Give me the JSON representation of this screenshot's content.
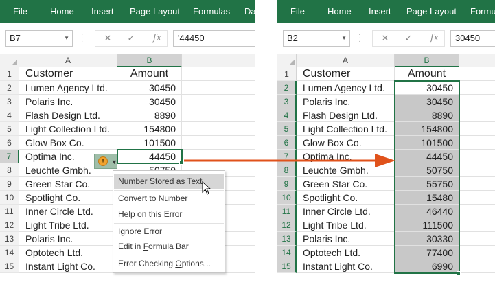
{
  "ribbon": {
    "left_tabs": [
      "File",
      "Home",
      "Insert",
      "Page Layout",
      "Formulas",
      "Da"
    ],
    "right_tabs": [
      "File",
      "Home",
      "Insert",
      "Page Layout",
      "Formu"
    ]
  },
  "formula_bar": {
    "left": {
      "namebox": "B7",
      "formula": "'44450"
    },
    "right": {
      "namebox": "B2",
      "formula": "30450"
    },
    "cancel_glyph": "✕",
    "enter_glyph": "✓",
    "fx_label": "fx"
  },
  "columns": {
    "a": "A",
    "b": "B"
  },
  "sheet": {
    "header": {
      "customer": "Customer",
      "amount": "Amount"
    },
    "rows": [
      {
        "n": "1"
      },
      {
        "n": "2",
        "customer": "Lumen Agency Ltd.",
        "amount": "30450"
      },
      {
        "n": "3",
        "customer": "Polaris Inc.",
        "amount": "30450"
      },
      {
        "n": "4",
        "customer": "Flash Design Ltd.",
        "amount": "8890"
      },
      {
        "n": "5",
        "customer": "Light Collection Ltd.",
        "amount": "154800"
      },
      {
        "n": "6",
        "customer": "Glow Box Co.",
        "amount": "101500"
      },
      {
        "n": "7",
        "customer": "Optima Inc.",
        "amount": "44450"
      },
      {
        "n": "8",
        "customer": "Leuchte Gmbh.",
        "amount": "50750"
      },
      {
        "n": "9",
        "customer": "Green Star Co.",
        "amount": "55750"
      },
      {
        "n": "10",
        "customer": "Spotlight Co.",
        "amount": "15480"
      },
      {
        "n": "11",
        "customer": "Inner Circle Ltd.",
        "amount": "46440"
      },
      {
        "n": "12",
        "customer": "Light Tribe Ltd.",
        "amount": "111500"
      },
      {
        "n": "13",
        "customer": "Polaris Inc.",
        "amount": "30330"
      },
      {
        "n": "14",
        "customer": "Optotech Ltd.",
        "amount": "77400"
      },
      {
        "n": "15",
        "customer": "Instant Light Co.",
        "amount": "6990"
      }
    ],
    "left_partial_amount": "6990"
  },
  "error_menu": {
    "items": [
      "Number Stored as Text",
      "Convert to Number",
      "Help on this Error",
      "Ignore Error",
      "Edit in Formula Bar",
      "Error Checking Options..."
    ],
    "highlighted_index": 0
  },
  "icons": {
    "error_icon": "warning-icon",
    "error_glyph": "!",
    "caret_glyph": "▼",
    "arrow": "orange-arrow-icon",
    "arrow_color": "#e0521b",
    "accent_color": "#217346"
  }
}
